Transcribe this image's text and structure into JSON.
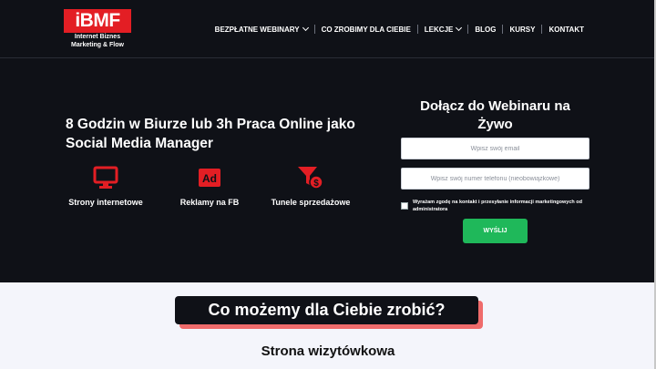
{
  "logo": {
    "brand": "iBMF",
    "line1": "Internet Biznes",
    "line2": "Marketing & Flow"
  },
  "nav": {
    "items": [
      {
        "label": "BEZPŁATNE WEBINARY",
        "has_dropdown": true
      },
      {
        "label": "CO ZROBIMY DLA CIEBIE",
        "has_dropdown": false
      },
      {
        "label": "LEKCJE",
        "has_dropdown": true
      },
      {
        "label": "BLOG",
        "has_dropdown": false
      },
      {
        "label": "KURSY",
        "has_dropdown": false
      },
      {
        "label": "KONTAKT",
        "has_dropdown": false
      }
    ]
  },
  "hero": {
    "title": "8 Godzin w Biurze lub 3h Praca Online jako Social Media Manager",
    "features": [
      {
        "label": "Strony internetowe",
        "icon": "monitor-icon"
      },
      {
        "label": "Reklamy na FB",
        "icon": "ad-icon"
      },
      {
        "label": "Tunele sprzedażowe",
        "icon": "funnel-dollar-icon"
      }
    ]
  },
  "form": {
    "title": "Dołącz do Webinaru na Żywo",
    "email_placeholder": "Wpisz swój email",
    "phone_placeholder": "Wpisz swój numer telefonu (nieobowiązkowe)",
    "consent": "Wyrażam zgodę na kontakt i przesyłanie informacji marketingowych od administratora",
    "submit": "WYŚLIJ"
  },
  "section": {
    "heading": "Co możemy dla Ciebie zrobić?",
    "subheading": "Strona wizytówkowa"
  },
  "colors": {
    "accent": "#e31e24",
    "dark": "#0f1117",
    "button": "#1fb85a",
    "light_bg": "#f4f5fb"
  }
}
